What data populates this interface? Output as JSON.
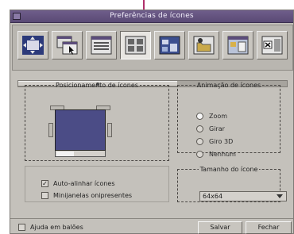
{
  "window": {
    "title": "Preferências de ícones"
  },
  "toolbar": {
    "tools": [
      {
        "name": "tool-desktop-position",
        "icon": "move-arrows-icon"
      },
      {
        "name": "tool-windows",
        "icon": "windows-cursor-icon"
      },
      {
        "name": "tool-list",
        "icon": "list-window-icon"
      },
      {
        "name": "tool-icons",
        "icon": "icon-grid-icon",
        "active": true
      },
      {
        "name": "tool-desktop",
        "icon": "desktop-screen-icon"
      },
      {
        "name": "tool-folders",
        "icon": "folders-icon"
      },
      {
        "name": "tool-files",
        "icon": "files-window-icon"
      },
      {
        "name": "tool-close-window",
        "icon": "close-window-icon"
      }
    ]
  },
  "positioning": {
    "legend": "Posicionamento de ícones"
  },
  "animation": {
    "legend": "Animação de ícones",
    "options": [
      "Zoom",
      "Girar",
      "Giro 3D",
      "Nenhum"
    ],
    "selected": "Zoom"
  },
  "options": {
    "auto_align": {
      "label": "Auto-alinhar ícones",
      "checked": true
    },
    "mini_windows": {
      "label": "Minijanelas onipresentes",
      "checked": false
    }
  },
  "icon_size": {
    "legend": "Tamanho do ícone",
    "value": "64x64"
  },
  "footer": {
    "balloon_help": {
      "label": "Ajuda em balões",
      "checked": false
    },
    "save_label": "Salvar",
    "close_label": "Fechar"
  },
  "colors": {
    "titlebar": "#6f5e8b",
    "window_bg": "#c4c1bb",
    "preview_screen": "#4b4c86"
  }
}
